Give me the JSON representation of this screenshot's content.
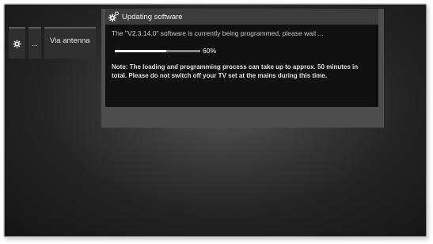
{
  "tabs": {
    "settings_icon": "gear-icon",
    "more_label": "...",
    "source_label": "Via antenna"
  },
  "dialog": {
    "icon": "gears-icon",
    "title": "Updating software",
    "status": "The \"V2.3.14.0\" software is currently being programmed, please wait ...",
    "progress_fraction": 0.6,
    "progress_label": "60%",
    "note": "Note: The loading and programming process can take up to approx. 50 minutes in total. Please do not switch off your TV set at the mains during this time."
  },
  "colors": {
    "progress_fill": "#ffffff",
    "progress_track": "#8a8a8a",
    "dialog_header": "#3c3c3c",
    "dialog_body": "#101010"
  }
}
